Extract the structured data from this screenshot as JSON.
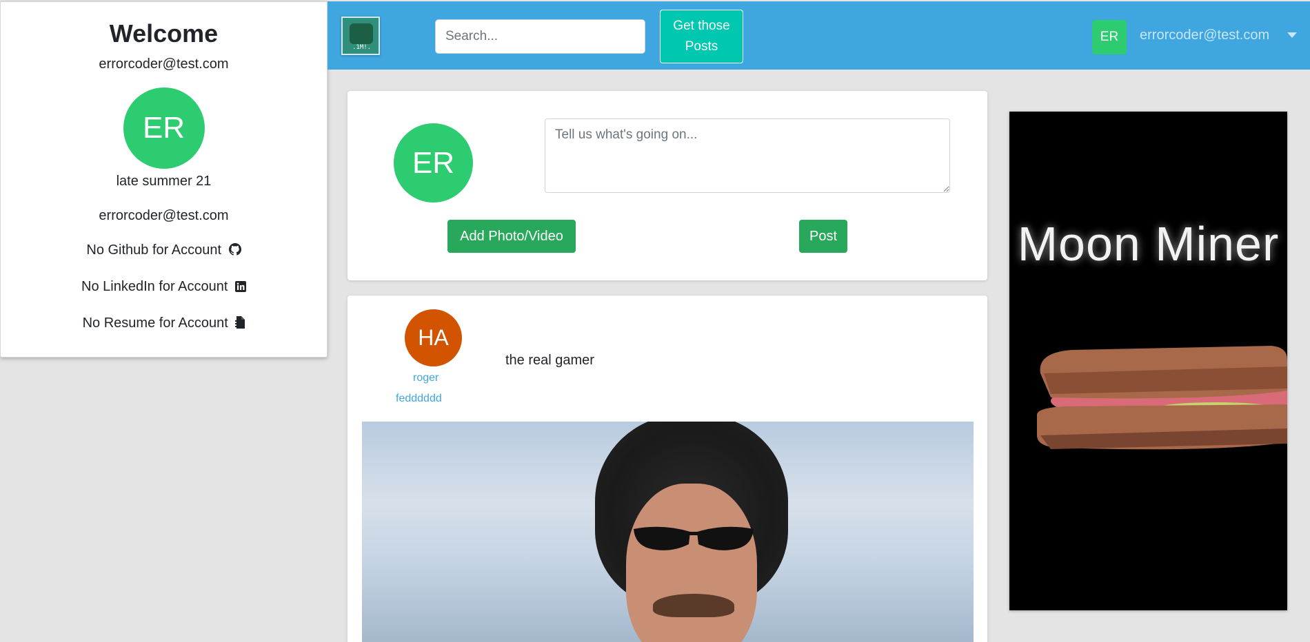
{
  "sidebar": {
    "welcome": "Welcome",
    "email": "errorcoder@test.com",
    "avatar_initials": "ER",
    "season": "late summer 21",
    "email_repeat": "errorcoder@test.com",
    "github": "No Github for Account",
    "linkedin": "No LinkedIn for Account",
    "resume": "No Resume for Account",
    "icons": [
      "github-icon",
      "linkedin-icon",
      "resume-icon"
    ]
  },
  "navbar": {
    "logo_icon": "app-logo-icon",
    "logo_text": ".1M!.",
    "search_placeholder": "Search...",
    "get_posts_line1": "Get those",
    "get_posts_line2": "Posts",
    "avatar_initials": "ER",
    "user_email": "errorcoder@test.com",
    "dropdown_icon": "caret-down-icon"
  },
  "composer": {
    "avatar_initials": "ER",
    "placeholder": "Tell us what's going on...",
    "add_photo_label": "Add Photo/Video",
    "post_label": "Post"
  },
  "post": {
    "avatar_initials": "HA",
    "author": "roger",
    "handle": "fedddddd",
    "text": "the real gamer"
  },
  "ad": {
    "title": "Moon Miner"
  },
  "colors": {
    "navbar": "#3fa6df",
    "avatar_green": "#2ecc71",
    "avatar_orange": "#d35400",
    "button_green": "#28a85a",
    "button_teal": "#00c7b0",
    "link_blue": "#3fa6df"
  }
}
